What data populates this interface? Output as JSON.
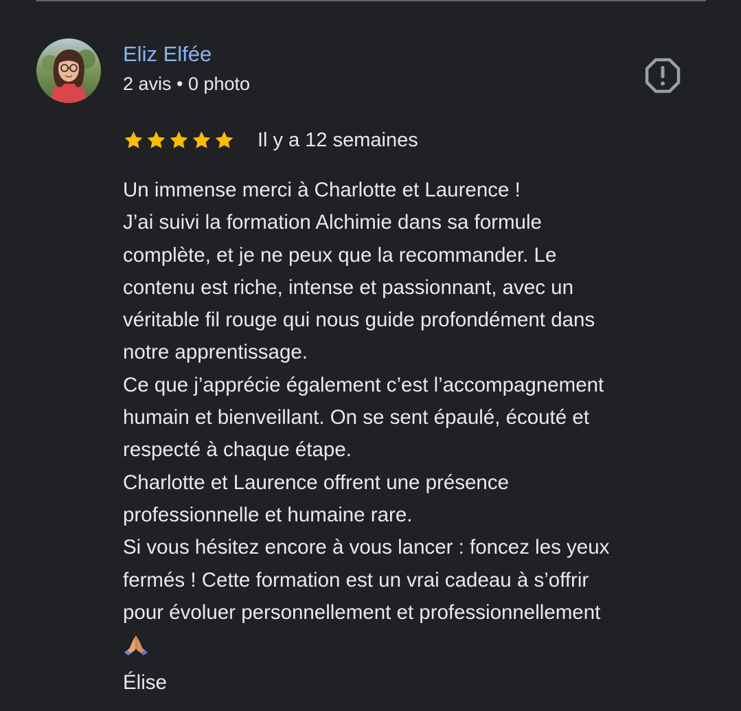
{
  "review": {
    "author": {
      "name": "Eliz Elfée",
      "meta": "2 avis • 0 photo",
      "avatar_icon": "profile-photo-woman-glasses"
    },
    "report_icon": "report-flag-icon",
    "rating": {
      "stars": 5,
      "max_stars": 5,
      "color": "#fbbc04"
    },
    "date": "Il y a 12 semaines",
    "text_lines": [
      "Un immense merci à Charlotte et Laurence !",
      "J’ai suivi la formation Alchimie dans sa formule",
      "complète, et je ne peux que la recommander. Le",
      "contenu est riche, intense et passionnant, avec un",
      "véritable fil rouge qui nous guide profondément dans",
      "notre apprentissage.",
      "Ce que j’apprécie également c’est l’accompagnement",
      "humain et bienveillant. On se sent épaulé, écouté et",
      "respecté à chaque étape.",
      "Charlotte et Laurence offrent une présence",
      "professionnelle et humaine rare.",
      "Si vous hésitez encore à vous lancer : foncez les yeux",
      "fermés ! Cette formation est un vrai cadeau à s’offrir",
      "pour évoluer personnellement et professionnellement"
    ],
    "emoji_icon": "folded-hands-emoji",
    "signature": "Élise"
  },
  "colors": {
    "background": "#202124",
    "text": "#e8eaed",
    "name": "#8ab4f8",
    "star": "#fbbc04",
    "icon": "#9aa0a6"
  }
}
